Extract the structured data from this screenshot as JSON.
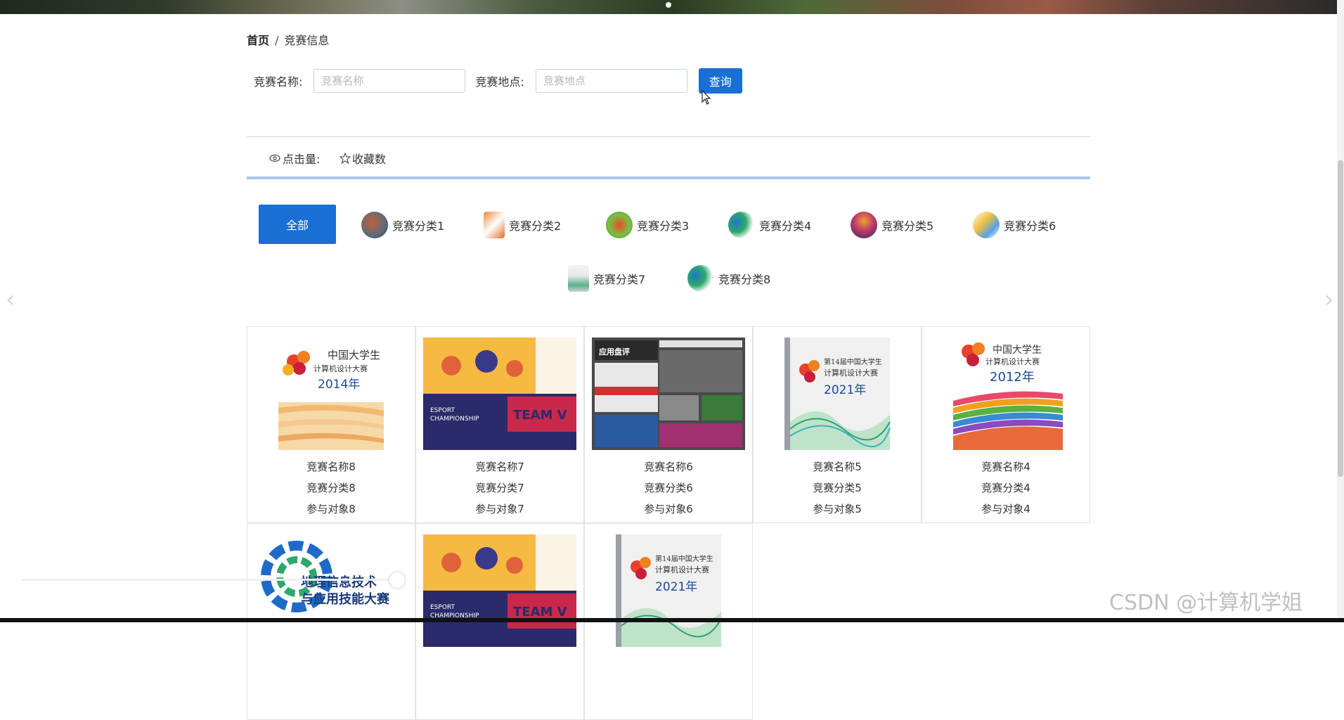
{
  "breadcrumb": {
    "home": "首页",
    "separator": "/",
    "current": "竞赛信息"
  },
  "search": {
    "name_label": "竞赛名称:",
    "name_placeholder": "竞赛名称",
    "location_label": "竞赛地点:",
    "location_placeholder": "竞赛地点",
    "query_button": "查询"
  },
  "stats": {
    "clicks_label": "点击量:",
    "favorites_label": "收藏数"
  },
  "categories": {
    "all_label": "全部",
    "items": [
      {
        "label": "竞赛分类1"
      },
      {
        "label": "竞赛分类2"
      },
      {
        "label": "竞赛分类3"
      },
      {
        "label": "竞赛分类4"
      },
      {
        "label": "竞赛分类5"
      },
      {
        "label": "竞赛分类6"
      },
      {
        "label": "竞赛分类7"
      },
      {
        "label": "竞赛分类8"
      }
    ]
  },
  "cards": [
    {
      "name": "竞赛名称8",
      "category": "竞赛分类8",
      "audience": "参与对象8",
      "cover_title": "中国大学生",
      "cover_subtitle": "计算机设计大赛",
      "cover_year": "2014年"
    },
    {
      "name": "竞赛名称7",
      "category": "竞赛分类7",
      "audience": "参与对象7",
      "cover_title": "ESPORT",
      "cover_subtitle": "CHAMPIONSHIP",
      "cover_year": "TEAM V"
    },
    {
      "name": "竞赛名称6",
      "category": "竞赛分类6",
      "audience": "参与对象6",
      "cover_title": "应用盘评",
      "cover_subtitle": "",
      "cover_year": ""
    },
    {
      "name": "竞赛名称5",
      "category": "竞赛分类5",
      "audience": "参与对象5",
      "cover_title": "第14届中国大学生",
      "cover_subtitle": "计算机设计大赛",
      "cover_year": "2021年"
    },
    {
      "name": "竞赛名称4",
      "category": "竞赛分类4",
      "audience": "参与对象4",
      "cover_title": "中国大学生",
      "cover_subtitle": "计算机设计大赛",
      "cover_year": "2012年"
    },
    {
      "name": "",
      "category": "",
      "audience": "",
      "cover_title": "地理信息技术",
      "cover_subtitle": "与应用技能大赛",
      "cover_year": ""
    },
    {
      "name": "",
      "category": "",
      "audience": "",
      "cover_title": "ESPORT",
      "cover_subtitle": "CHAMPIONSHIP",
      "cover_year": "TEAM V"
    },
    {
      "name": "",
      "category": "",
      "audience": "",
      "cover_title": "第14届中国大学生",
      "cover_subtitle": "计算机设计大赛",
      "cover_year": "2021年"
    }
  ],
  "watermark": "CSDN @计算机学姐",
  "colors": {
    "primary": "#1a6fd4",
    "accent_line": "#a8c6ee"
  }
}
